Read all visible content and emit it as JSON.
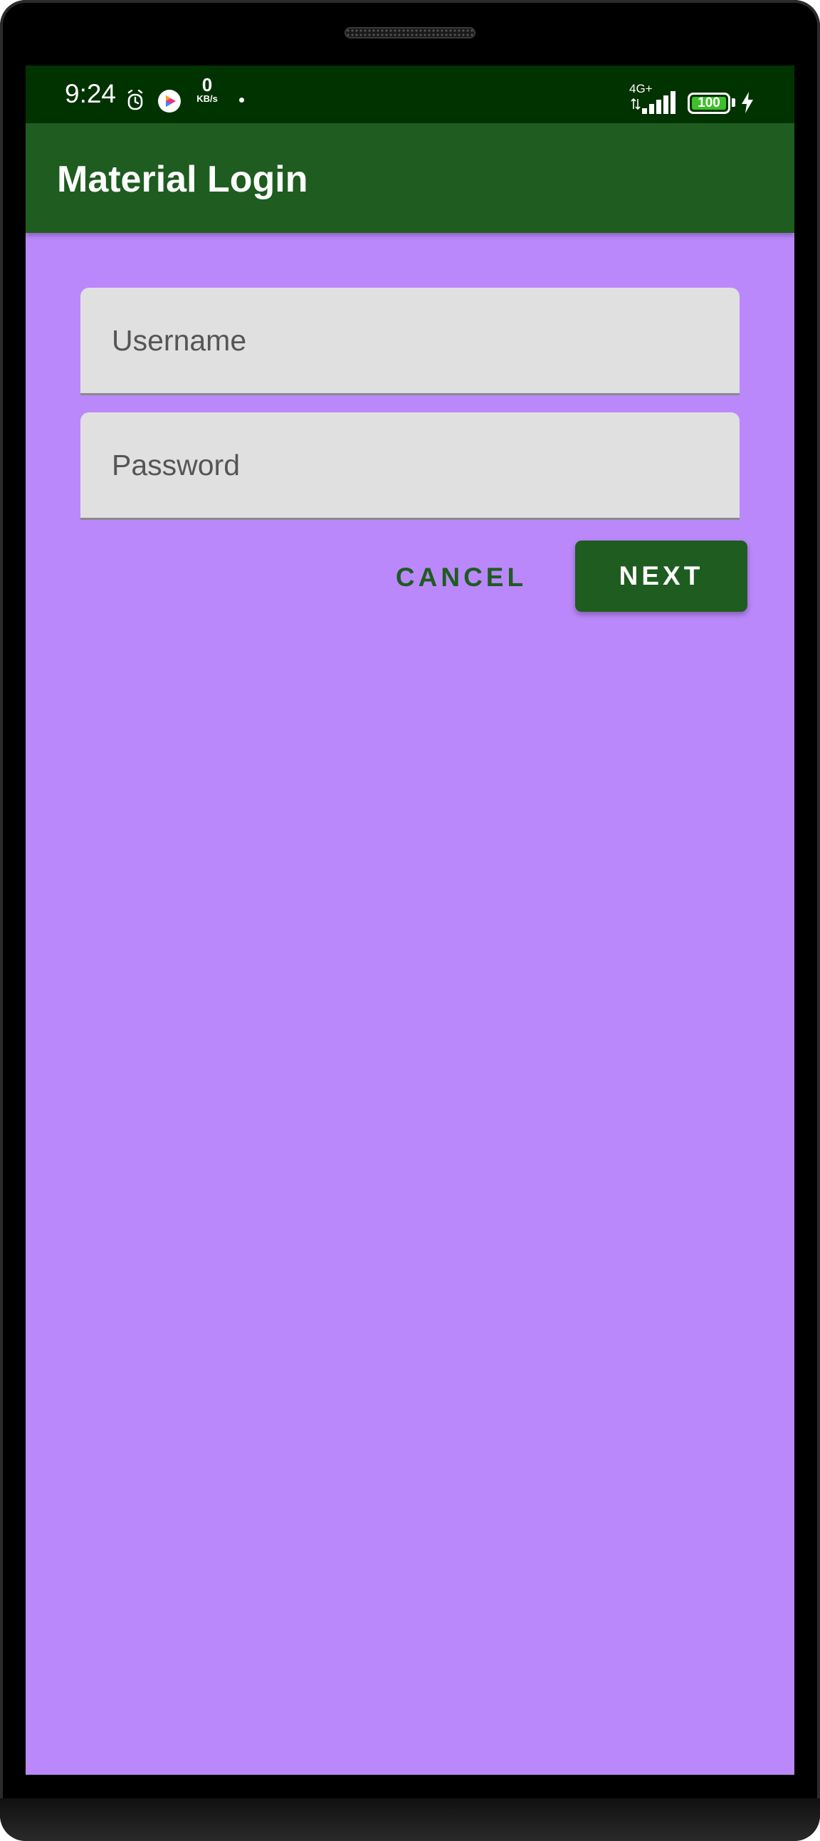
{
  "status_bar": {
    "time": "9:24",
    "data_speed_value": "0",
    "data_speed_unit": "KB/s",
    "network_type": "4G+",
    "battery_level": "100",
    "icons": [
      "alarm-icon",
      "media-player-icon",
      "notification-dot-icon",
      "signal-icon",
      "battery-icon",
      "charging-icon"
    ]
  },
  "app_bar": {
    "title": "Material Login"
  },
  "form": {
    "username": {
      "placeholder": "Username",
      "value": ""
    },
    "password": {
      "placeholder": "Password",
      "value": ""
    }
  },
  "actions": {
    "cancel_label": "CANCEL",
    "next_label": "NEXT"
  },
  "colors": {
    "background": "#bb88fb",
    "status_bar": "#013300",
    "app_bar": "#1e5c20",
    "primary": "#1e5c20",
    "field_fill": "#e0e0e0",
    "battery_fill": "#3fbf2a"
  }
}
